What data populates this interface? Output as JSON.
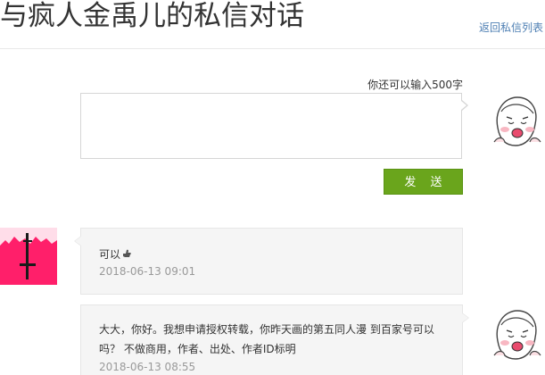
{
  "header": {
    "title": "与疯人金禹儿的私信对话",
    "back_link": "返回私信列表"
  },
  "compose": {
    "char_count": "你还可以输入500字",
    "placeholder": "",
    "send_label": "发 送"
  },
  "messages": [
    {
      "sender": "other",
      "text": "可以",
      "emoji_icon": "thumbs-up-icon",
      "time": "2018-06-13 09:01"
    },
    {
      "sender": "me",
      "text": "大大，你好。我想申请授权转载，你昨天画的第五同人漫 到百家号可以吗？ 不做商用，作者、出处、作者ID标明",
      "time": "2018-06-13 08:55"
    }
  ],
  "colors": {
    "accent_green": "#6aa51c",
    "link_blue": "#4e7fb3",
    "bubble_bg": "#f5f5f5",
    "other_avatar_bg": "#ff1f6a"
  }
}
